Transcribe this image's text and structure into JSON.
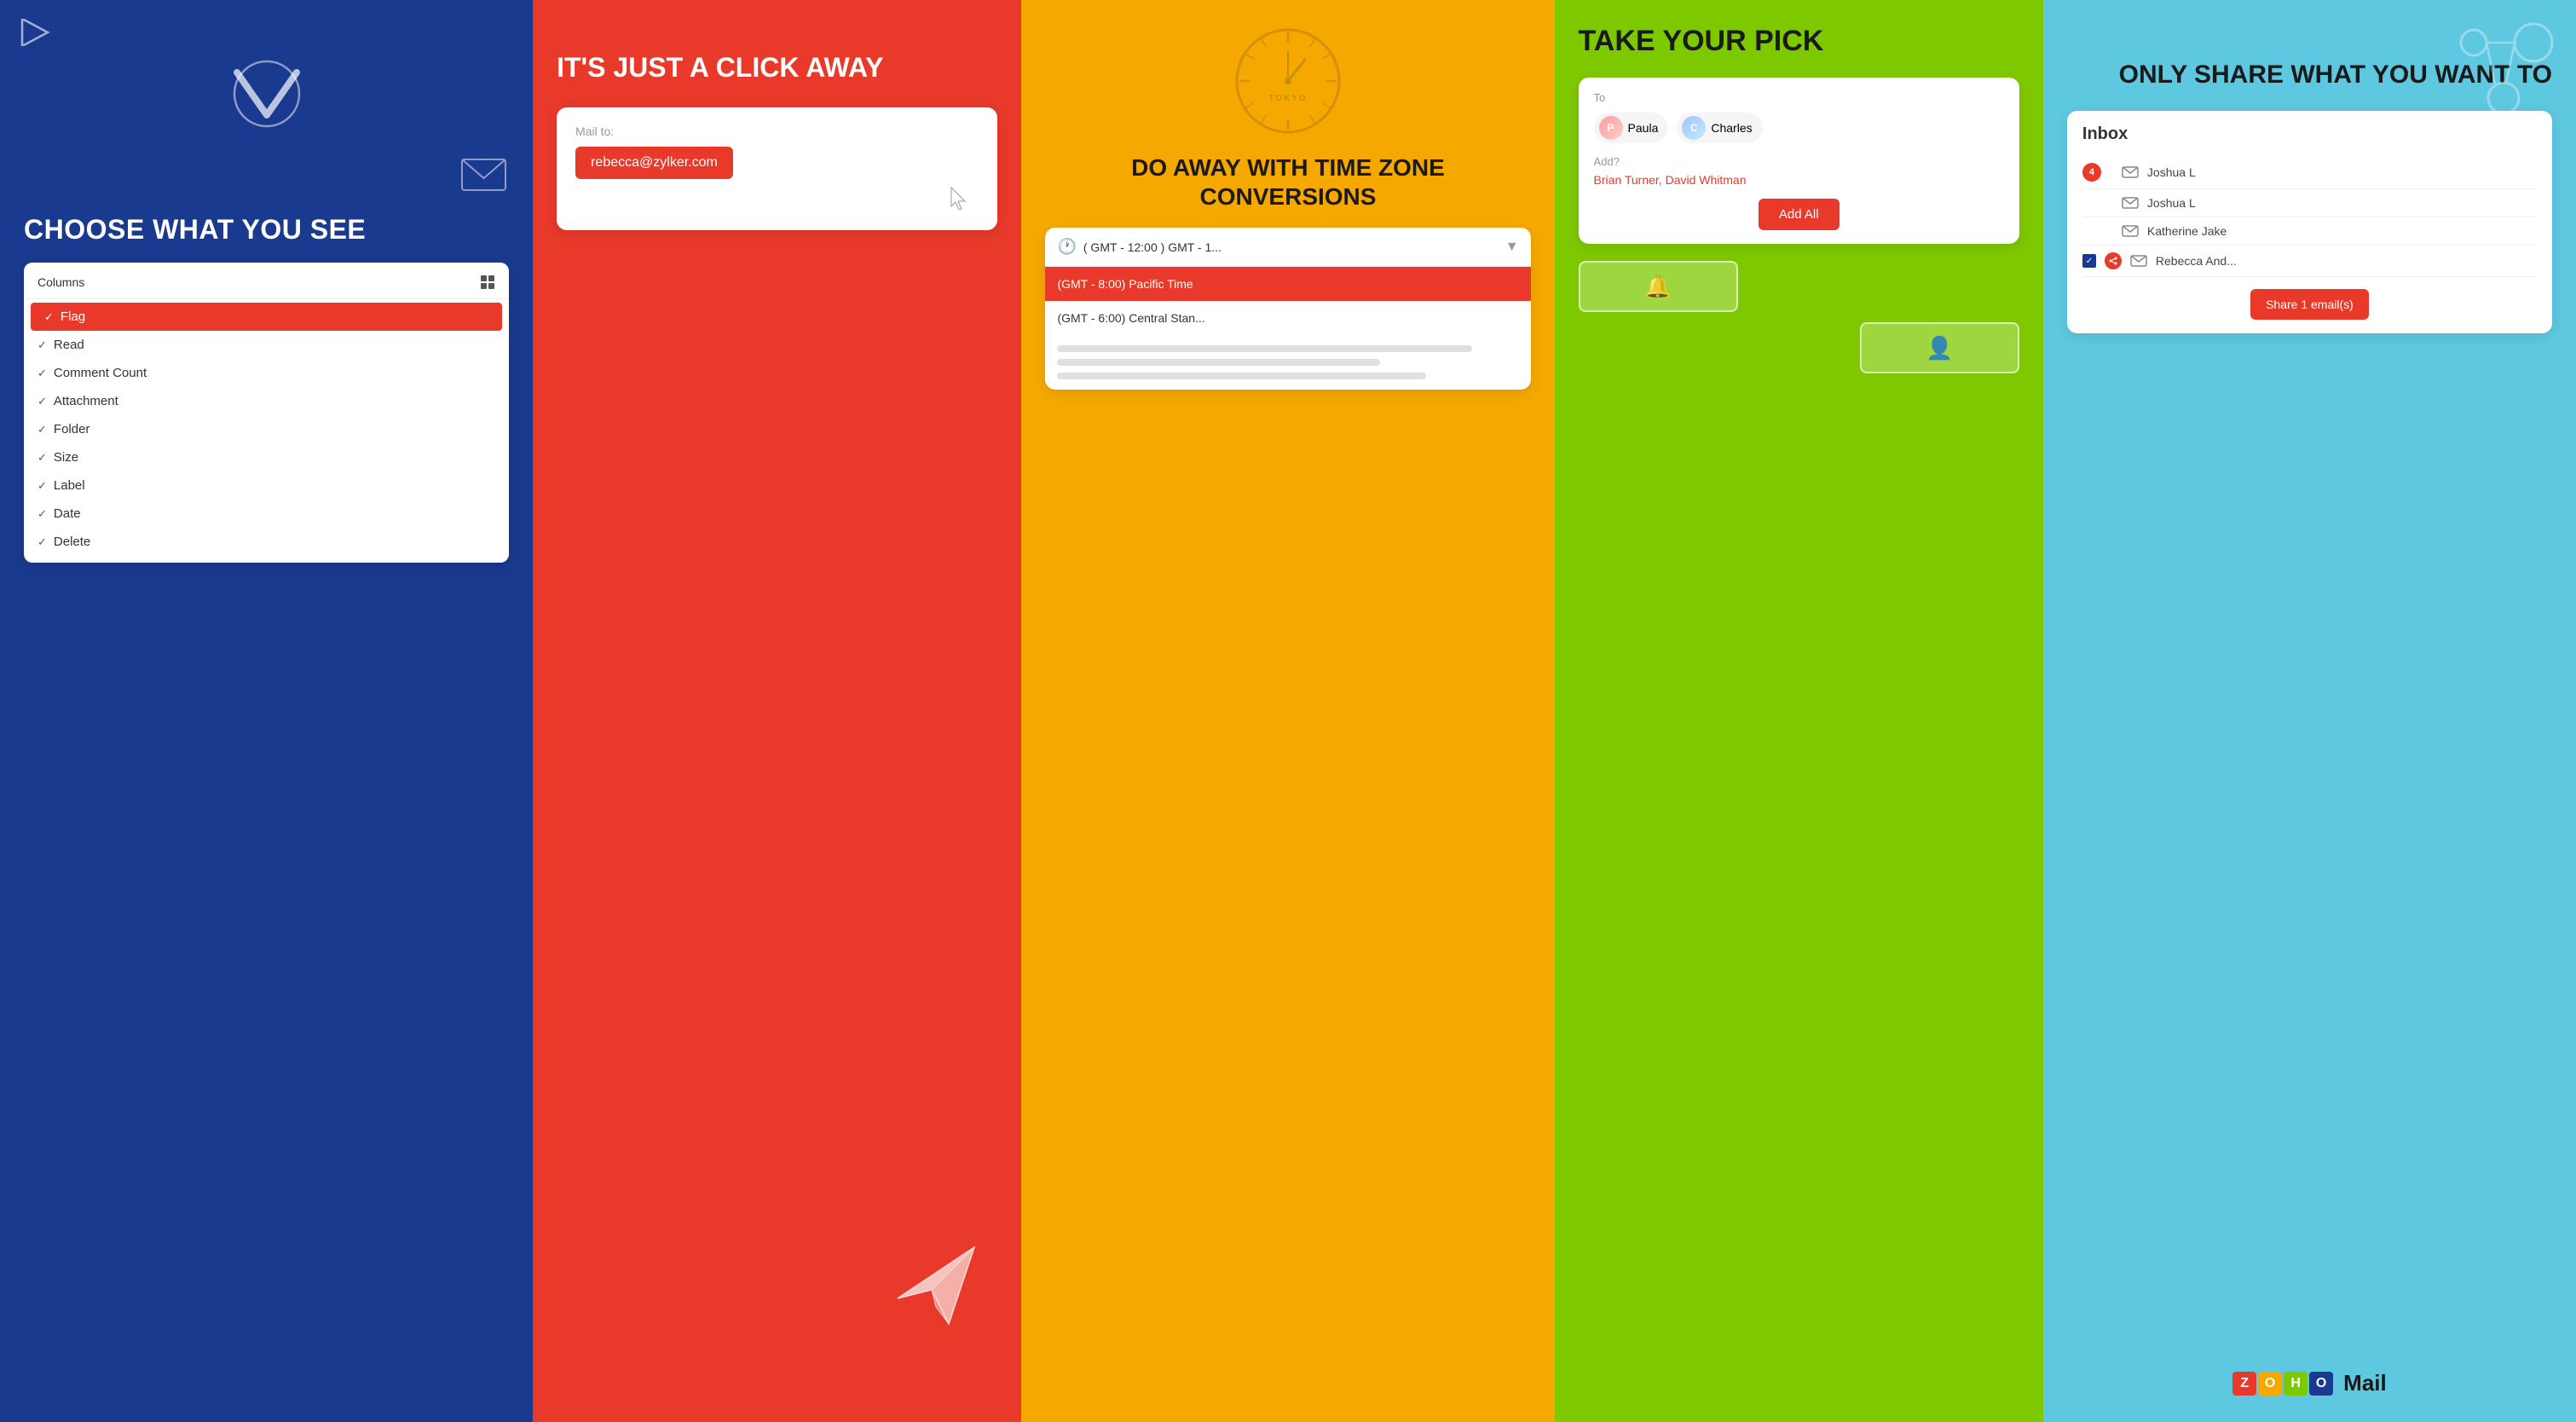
{
  "panels": {
    "panel1": {
      "title": "CHOOSE WHAT YOU SEE",
      "items": [
        {
          "label": "Flag",
          "active": true,
          "checked": true
        },
        {
          "label": "Read",
          "active": false,
          "checked": true
        },
        {
          "label": "Comment Count",
          "active": false,
          "checked": true
        },
        {
          "label": "Attachment",
          "active": false,
          "checked": true
        },
        {
          "label": "Folder",
          "active": false,
          "checked": true
        },
        {
          "label": "Size",
          "active": false,
          "checked": true
        },
        {
          "label": "Label",
          "active": false,
          "checked": true
        },
        {
          "label": "Date",
          "active": false,
          "checked": true
        },
        {
          "label": "Delete",
          "active": false,
          "checked": true
        }
      ]
    },
    "panel2": {
      "title": "IT'S JUST A CLICK AWAY",
      "mail_to_label": "Mail to:",
      "email": "rebecca@zylker.com"
    },
    "panel3": {
      "title": "DO AWAY WITH TIME ZONE CONVERSIONS",
      "clock_label": "TOKYO",
      "timezone_selected": "( GMT - 12:00 ) GMT - 1...",
      "timezones": [
        {
          "label": "(GMT - 8:00) Pacific Time",
          "selected": true
        },
        {
          "label": "(GMT - 6:00) Central Stan...",
          "selected": false
        }
      ]
    },
    "panel4": {
      "title": "TAKE YOUR PICK",
      "to_label": "To",
      "contacts": [
        {
          "name": "Paula",
          "initials": "P"
        },
        {
          "name": "Charles",
          "initials": "C"
        }
      ],
      "add_label": "Add?",
      "suggested": "Brian Turner, David Whitman",
      "add_all_btn": "Add All"
    },
    "panel5": {
      "title": "ONLY SHARE WHAT YOU WANT TO",
      "inbox_title": "Inbox",
      "inbox_items": [
        {
          "name": "Joshua L",
          "badge": "4",
          "show_badge": true
        },
        {
          "name": "Joshua L",
          "badge": "",
          "show_badge": false
        },
        {
          "name": "Katherine Jake",
          "badge": "",
          "show_badge": false
        },
        {
          "name": "Rebecca And...",
          "badge": "",
          "show_badge": false,
          "checked": true,
          "share_tag": true
        }
      ],
      "share_btn": "Share 1 email(s)",
      "zoho_letters": [
        "Z",
        "O",
        "H",
        "O"
      ],
      "mail_label": "Mail"
    }
  }
}
